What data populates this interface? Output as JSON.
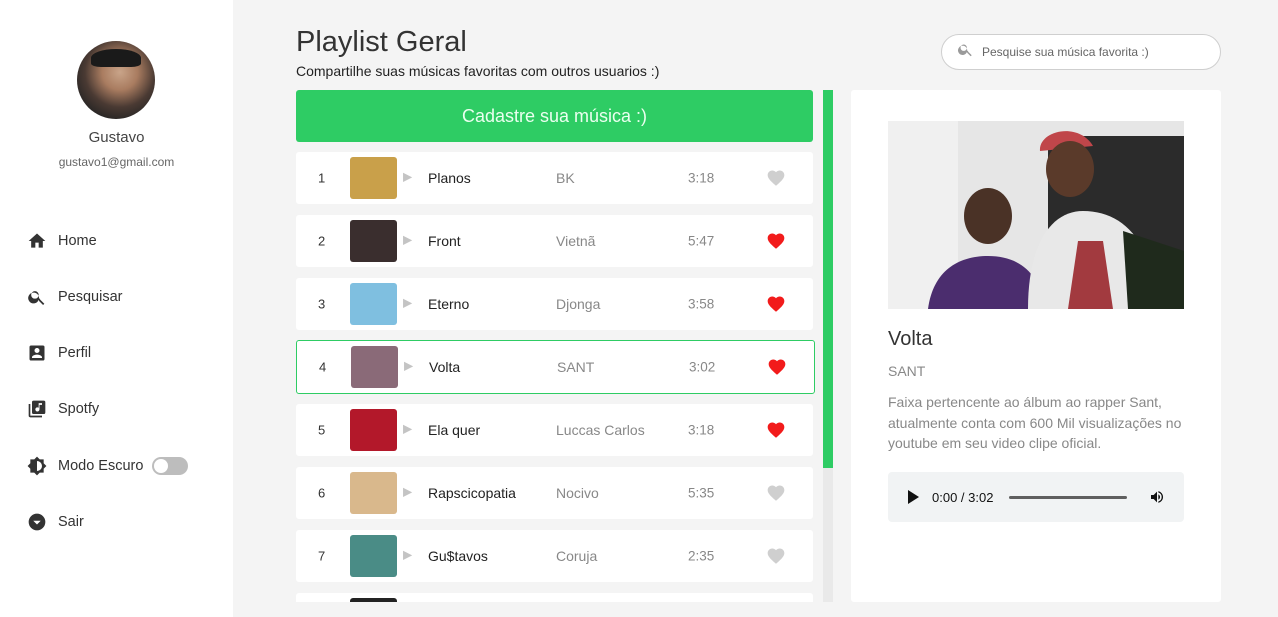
{
  "user": {
    "name": "Gustavo",
    "email": "gustavo1@gmail.com"
  },
  "nav": [
    {
      "label": "Home",
      "icon": "home-icon"
    },
    {
      "label": "Pesquisar",
      "icon": "search-icon"
    },
    {
      "label": "Perfil",
      "icon": "profile-icon"
    },
    {
      "label": "Spotfy",
      "icon": "library-icon"
    },
    {
      "label": "Modo Escuro",
      "icon": "brightness-icon",
      "toggle": false
    },
    {
      "label": "Sair",
      "icon": "logout-icon"
    }
  ],
  "header": {
    "title": "Playlist Geral",
    "subtitle": "Compartilhe suas músicas favoritas com outros usuarios :)"
  },
  "search": {
    "placeholder": "Pesquise sua música favorita :)"
  },
  "register_button": "Cadastre sua música :)",
  "songs": [
    {
      "num": "1",
      "title": "Planos",
      "artist": "BK",
      "duration": "3:18",
      "liked": false,
      "thumb_color": "#c9a04a"
    },
    {
      "num": "2",
      "title": "Front",
      "artist": "Vietnã",
      "duration": "5:47",
      "liked": true,
      "thumb_color": "#3a2e2e"
    },
    {
      "num": "3",
      "title": "Eterno",
      "artist": "Djonga",
      "duration": "3:58",
      "liked": true,
      "thumb_color": "#7fbfe0"
    },
    {
      "num": "4",
      "title": "Volta",
      "artist": "SANT",
      "duration": "3:02",
      "liked": true,
      "thumb_color": "#8a6a78",
      "active": true
    },
    {
      "num": "5",
      "title": "Ela quer",
      "artist": "Luccas Carlos",
      "duration": "3:18",
      "liked": true,
      "thumb_color": "#b3182a"
    },
    {
      "num": "6",
      "title": "Rapscicopatia",
      "artist": "Nocivo",
      "duration": "5:35",
      "liked": false,
      "thumb_color": "#d9b88c"
    },
    {
      "num": "7",
      "title": "Gu$tavos",
      "artist": "Coruja",
      "duration": "2:35",
      "liked": false,
      "thumb_color": "#4a8c86"
    },
    {
      "num": "",
      "title": "",
      "artist": "",
      "duration": "",
      "liked": false,
      "thumb_color": "#222222"
    }
  ],
  "detail": {
    "title": "Volta",
    "artist": "SANT",
    "description": "Faixa pertencente ao álbum ao rapper Sant, atualmente conta com 600 Mil visualizações no youtube em seu video clipe oficial.",
    "player_time": "0:00 / 3:02"
  },
  "colors": {
    "accent": "#2ecc64",
    "heart_liked": "#f21b1b",
    "heart_unliked": "#cfcfcf"
  }
}
